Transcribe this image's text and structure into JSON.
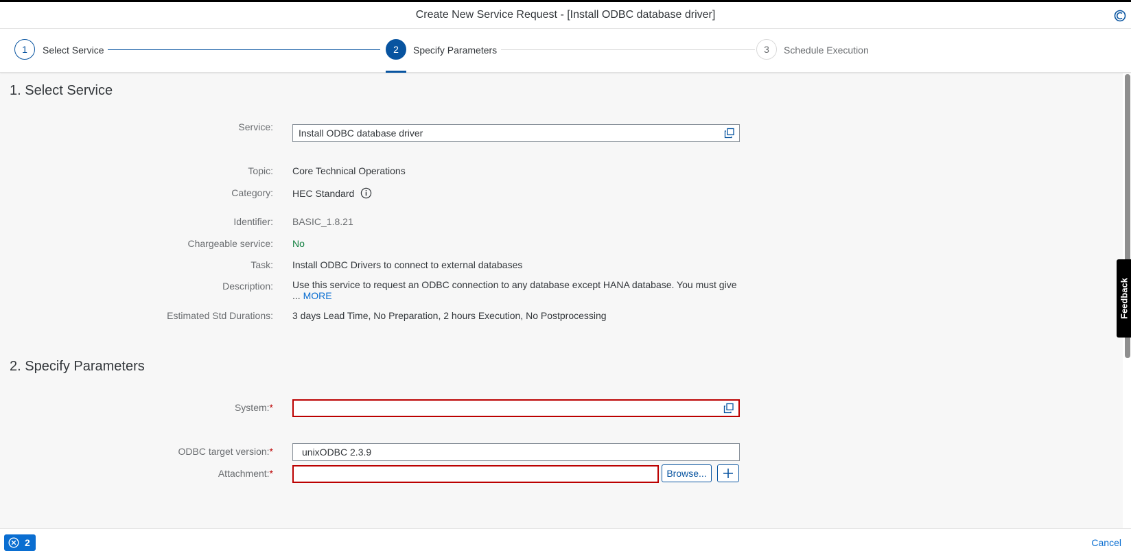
{
  "window": {
    "title": "Create New Service Request - [Install ODBC database driver]"
  },
  "wizard": {
    "steps": [
      {
        "number": "1",
        "label": "Select Service"
      },
      {
        "number": "2",
        "label": "Specify Parameters"
      },
      {
        "number": "3",
        "label": "Schedule Execution"
      }
    ]
  },
  "section1": {
    "title": "1. Select Service",
    "service_label": "Service:",
    "service_value": "Install ODBC database driver",
    "topic_label": "Topic:",
    "topic_value": "Core Technical Operations",
    "category_label": "Category:",
    "category_value": "HEC Standard",
    "identifier_label": "Identifier:",
    "identifier_value": "BASIC_1.8.21",
    "chargeable_label": "Chargeable service:",
    "chargeable_value": "No",
    "task_label": "Task:",
    "task_value": "Install ODBC Drivers to connect to external databases",
    "description_label": "Description:",
    "description_value": "Use this service to request an ODBC connection to any database except HANA database. You must give",
    "description_ellipsis": "...",
    "description_more": "MORE",
    "durations_label": "Estimated Std Durations:",
    "durations_value": "3 days Lead Time, No Preparation, 2 hours Execution, No Postprocessing"
  },
  "section2": {
    "title": "2. Specify Parameters",
    "system_label": "System:",
    "system_value": "",
    "odbc_label": "ODBC target version:",
    "odbc_value": "unixODBC 2.3.9",
    "attachment_label": "Attachment:",
    "attachment_value": "",
    "browse_label": "Browse...",
    "required_mark": "*"
  },
  "sidebar": {
    "feedback_label": "Feedback"
  },
  "footer": {
    "message_count": "2",
    "cancel_label": "Cancel"
  },
  "colors": {
    "accent": "#0a6ed1",
    "active_step": "#0854a0",
    "error": "#bb0000",
    "positive": "#107e3e"
  }
}
